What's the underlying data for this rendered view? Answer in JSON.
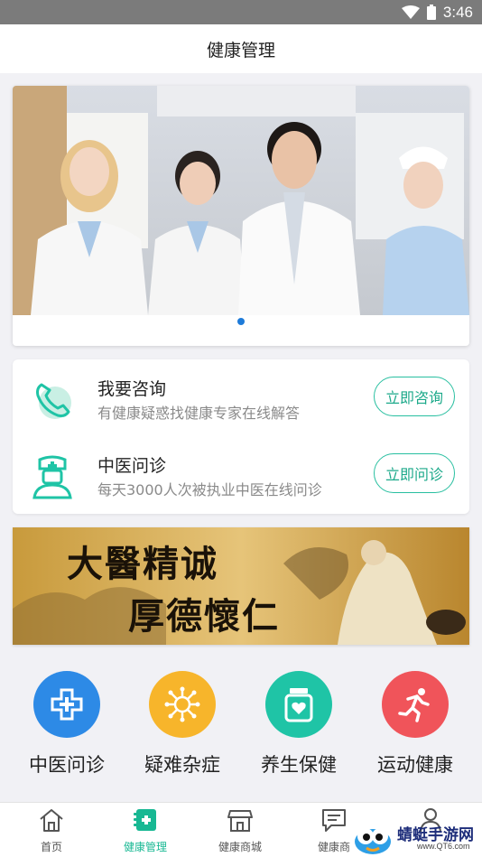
{
  "status_bar": {
    "time": "3:46",
    "wifi_icon": "wifi-icon",
    "battery_icon": "battery-icon"
  },
  "header": {
    "title": "健康管理"
  },
  "banner": {
    "image": "doctors-group-photo",
    "pages": 1,
    "active_page": 1
  },
  "services": [
    {
      "title": "我要咨询",
      "subtitle": "有健康疑惑找健康专家在线解答",
      "button": "立即咨询",
      "icon": "phone-consult-icon"
    },
    {
      "title": "中医问诊",
      "subtitle": "每天3000人次被执业中医在线问诊",
      "button": "立即问诊",
      "icon": "nurse-icon"
    }
  ],
  "ad_banner": {
    "line1": "大醫精诚",
    "line2": "厚德懷仁"
  },
  "categories": [
    {
      "label": "中医问诊",
      "icon": "medical-cross-icon",
      "color": "#2d8ae6"
    },
    {
      "label": "疑难杂症",
      "icon": "virus-icon",
      "color": "#f7b52b"
    },
    {
      "label": "养生保健",
      "icon": "health-jar-icon",
      "color": "#1fc4a6"
    },
    {
      "label": "运动健康",
      "icon": "running-icon",
      "color": "#f0545a"
    }
  ],
  "bottom_nav": [
    {
      "label": "首页",
      "icon": "home-icon",
      "active": false
    },
    {
      "label": "健康管理",
      "icon": "health-card-icon",
      "active": true
    },
    {
      "label": "健康商城",
      "icon": "store-icon",
      "active": false
    },
    {
      "label": "健康商",
      "icon": "chat-icon",
      "active": false
    },
    {
      "label": "",
      "icon": "user-icon",
      "active": false
    }
  ],
  "watermark": {
    "text": "蜻蜓手游网",
    "url": "www.QT6.com"
  },
  "colors": {
    "accent": "#18b893",
    "page_bg": "#f1f1f5",
    "status_bar": "#7b7b7b"
  }
}
